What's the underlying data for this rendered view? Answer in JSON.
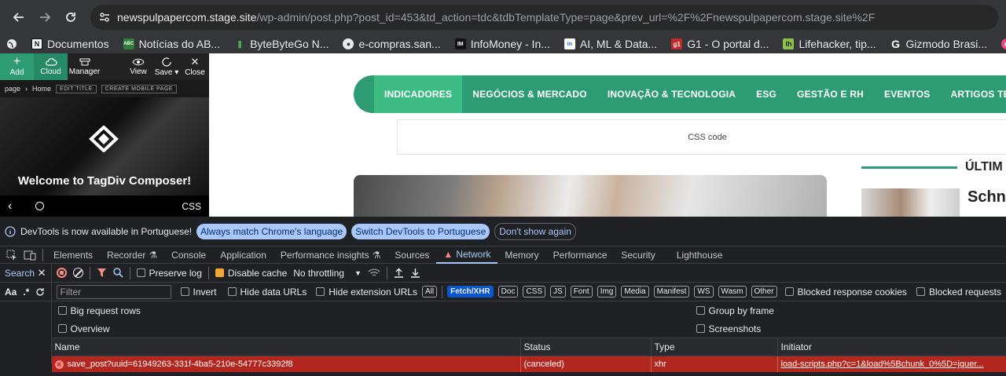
{
  "browser": {
    "url_host": "newspulpapercom.stage.site",
    "url_path": "/wp-admin/post.php?post_id=453&td_action=tdc&tdbTemplateType=page&prev_url=%2F%2Fnewspulpapercom.stage.site%2F"
  },
  "bookmarks": [
    {
      "label": "Documentos",
      "icon": "doc-icon",
      "color": "#ffffff"
    },
    {
      "label": "Notícias do AB...",
      "icon": "abc-icon",
      "color": "#2e7d32"
    },
    {
      "label": "ByteByteGo N...",
      "icon": "bytebytego-icon",
      "color": "#4caf50"
    },
    {
      "label": "e-compras.san...",
      "icon": "globe-icon",
      "color": "#9e9e9e"
    },
    {
      "label": "InfoMoney - In...",
      "icon": "infomoney-icon",
      "color": "#111111"
    },
    {
      "label": "AI, ML & Data...",
      "icon": "info-icon",
      "color": "#1565c0"
    },
    {
      "label": "G1 - O portal d...",
      "icon": "g1-icon",
      "color": "#c62828"
    },
    {
      "label": "Lifehacker, tip...",
      "icon": "lifehacker-icon",
      "color": "#8bc34a"
    },
    {
      "label": "Gizmodo Brasi...",
      "icon": "gizmodo-icon",
      "color": "#ffffff"
    }
  ],
  "tagdiv": {
    "toolbar": {
      "add": "Add",
      "cloud": "Cloud",
      "manager": "Manager",
      "view": "View",
      "save": "Save",
      "close": "Close"
    },
    "breadcrumb": {
      "page": "page",
      "home": "Home",
      "edit_title": "EDIT TITLE",
      "create_mobile": "CREATE MOBILE PAGE"
    },
    "welcome": "Welcome to TagDiv Composer!",
    "css_label": "CSS"
  },
  "site": {
    "nav": [
      "INDICADORES",
      "NEGÓCIOS & MERCADO",
      "INOVAÇÃO & TECNOLOGIA",
      "ESG",
      "GESTÃO E RH",
      "EVENTOS",
      "ARTIGOS TÉCNICOS"
    ],
    "css_code": "CSS code",
    "latest_heading": "ÚLTIM",
    "article_title": "Schne",
    "accent": "#2d9c73"
  },
  "devtools": {
    "infobar": {
      "message": "DevTools is now available in Portuguese!",
      "btn_match": "Always match Chrome's language",
      "btn_switch": "Switch DevTools to Portuguese",
      "btn_dismiss": "Don't show again"
    },
    "tabs": [
      "Elements",
      "Recorder",
      "Console",
      "Application",
      "Performance insights",
      "Sources",
      "Network",
      "Memory",
      "Performance",
      "Security",
      "Lighthouse"
    ],
    "search_label": "Search",
    "search_aa": "Aa",
    "search_regex": ".*",
    "toolbar": {
      "preserve_log": "Preserve log",
      "disable_cache": "Disable cache",
      "throttling": "No throttling"
    },
    "filter_placeholder": "Filter",
    "filter_opts": {
      "invert": "Invert",
      "hide_data": "Hide data URLs",
      "hide_ext": "Hide extension URLs"
    },
    "types": [
      "All",
      "Fetch/XHR",
      "Doc",
      "CSS",
      "JS",
      "Font",
      "Img",
      "Media",
      "Manifest",
      "WS",
      "Wasm",
      "Other"
    ],
    "blocked_response": "Blocked response cookies",
    "blocked_requests": "Blocked requests",
    "options": {
      "big_rows": "Big request rows",
      "overview": "Overview",
      "group_frame": "Group by frame",
      "screenshots": "Screenshots"
    },
    "columns": {
      "name": "Name",
      "status": "Status",
      "type": "Type",
      "initiator": "Initiator"
    },
    "rows": [
      {
        "name": "save_post?uuid=61949263-331f-4ba5-210e-54777c3392f8",
        "status": "(canceled)",
        "type": "xhr",
        "initiator": "load-scripts.php?c=1&load%5Bchunk_0%5D=jquer..."
      }
    ]
  }
}
